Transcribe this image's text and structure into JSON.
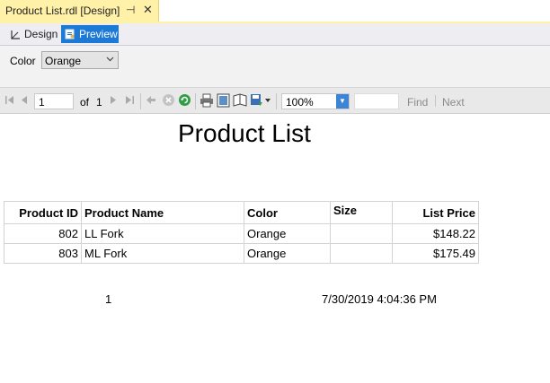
{
  "tab": {
    "title": "Product List.rdl [Design]",
    "pin_glyph": "⊣",
    "close_glyph": "✕"
  },
  "view": {
    "design_label": "Design",
    "preview_label": "Preview"
  },
  "parameters": {
    "color_label": "Color",
    "color_value": "Orange"
  },
  "toolbar": {
    "current_page": "1",
    "of_label": "of",
    "total_pages": "1",
    "zoom": "100%",
    "find_label": "Find",
    "next_label": "Next"
  },
  "report": {
    "title": "Product List",
    "columns": [
      "Product ID",
      "Product Name",
      "Color",
      "Size",
      "List Price"
    ],
    "rows": [
      {
        "id": "802",
        "name": "LL Fork",
        "color": "Orange",
        "size": "",
        "price": "$148.22"
      },
      {
        "id": "803",
        "name": "ML Fork",
        "color": "Orange",
        "size": "",
        "price": "$175.49"
      }
    ],
    "page_number": "1",
    "execution_time": "7/30/2019 4:04:36 PM"
  },
  "colors": {
    "tab_active": "#fff1a8",
    "preview_active": "#1c7ad6"
  }
}
